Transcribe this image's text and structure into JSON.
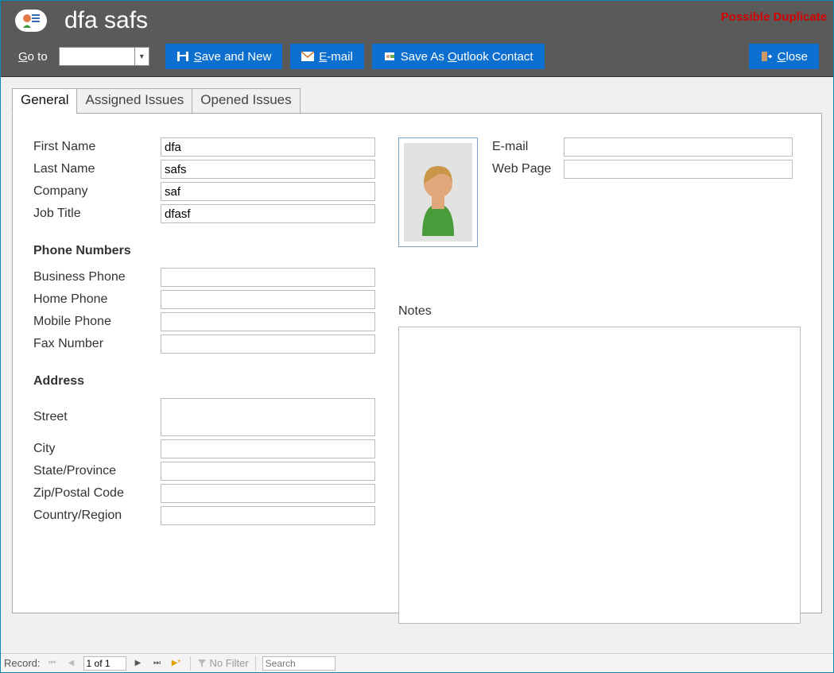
{
  "header": {
    "title": "dfa safs",
    "duplicate_warning": "Possible Duplicate"
  },
  "toolbar": {
    "goto_label_pre": "G",
    "goto_label_post": "o to",
    "goto_value": "",
    "save_new_pre": "S",
    "save_new_post": "ave and New",
    "email_pre": "E",
    "email_post": "-mail",
    "outlook_pre": "Save As ",
    "outlook_mid": "O",
    "outlook_post": "utlook Contact",
    "close_pre": "C",
    "close_post": "lose"
  },
  "tabs": {
    "general": "General",
    "assigned": "Assigned Issues",
    "opened": "Opened Issues"
  },
  "labels": {
    "first_name": "First Name",
    "last_name": "Last Name",
    "company": "Company",
    "job_title": "Job Title",
    "email": "E-mail",
    "web_page": "Web Page",
    "phone_section": "Phone Numbers",
    "business_phone": "Business Phone",
    "home_phone": "Home Phone",
    "mobile_phone": "Mobile Phone",
    "fax": "Fax Number",
    "address_section": "Address",
    "street": "Street",
    "city": "City",
    "state": "State/Province",
    "zip": "Zip/Postal Code",
    "country": "Country/Region",
    "notes": "Notes"
  },
  "values": {
    "first_name": "dfa",
    "last_name": "safs",
    "company": "saf",
    "job_title": "dfasf",
    "email": "",
    "web_page": "",
    "business_phone": "",
    "home_phone": "",
    "mobile_phone": "",
    "fax": "",
    "street": "",
    "city": "",
    "state": "",
    "zip": "",
    "country": "",
    "notes": ""
  },
  "statusbar": {
    "record_label": "Record:",
    "record_position": "1 of 1",
    "no_filter": "No Filter",
    "search_placeholder": "Search"
  }
}
